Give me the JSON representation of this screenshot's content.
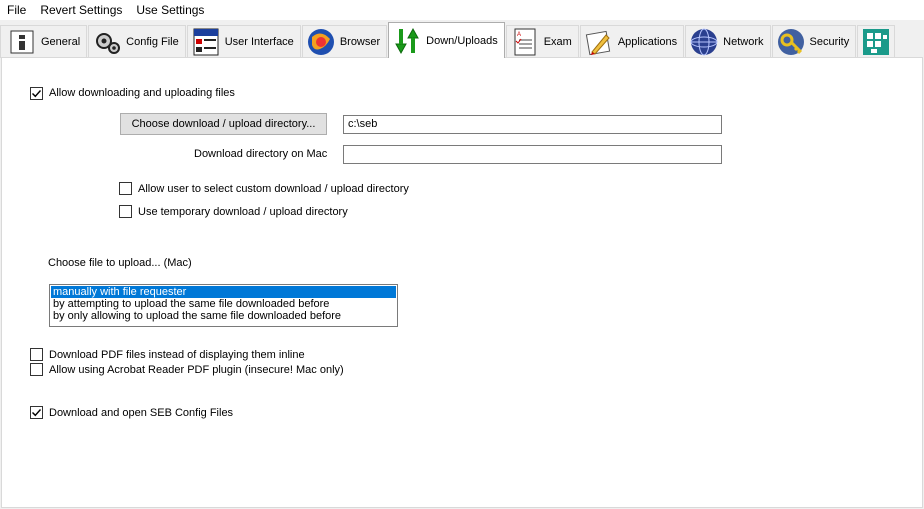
{
  "menu": {
    "file": "File",
    "revert": "Revert Settings",
    "use": "Use Settings"
  },
  "tabs": [
    {
      "label": "General",
      "icon": "general-icon"
    },
    {
      "label": "Config File",
      "icon": "config-file-icon"
    },
    {
      "label": "User Interface",
      "icon": "user-interface-icon"
    },
    {
      "label": "Browser",
      "icon": "browser-icon"
    },
    {
      "label": "Down/Uploads",
      "icon": "down-uploads-icon",
      "active": true
    },
    {
      "label": "Exam",
      "icon": "exam-icon"
    },
    {
      "label": "Applications",
      "icon": "applications-icon"
    },
    {
      "label": "Network",
      "icon": "network-icon"
    },
    {
      "label": "Security",
      "icon": "security-icon"
    },
    {
      "label": "",
      "icon": "registry-icon"
    }
  ],
  "downloads": {
    "allow_label": "Allow downloading and uploading files",
    "allow_checked": true,
    "choose_dir_button": "Choose download / upload directory...",
    "dir_value": "c:\\seb",
    "mac_dir_label": "Download directory on Mac",
    "mac_dir_value": "",
    "custom_dir_label": "Allow user to select custom download / upload directory",
    "custom_dir_checked": false,
    "temp_dir_label": "Use temporary download / upload directory",
    "temp_dir_checked": false,
    "upload_mode_label": "Choose file to upload... (Mac)",
    "upload_options": [
      "manually with file requester",
      "by attempting to upload the same file downloaded before",
      "by only allowing to upload the same file downloaded before"
    ],
    "upload_selected_index": 0,
    "pdf_label": "Download PDF files instead of displaying them inline",
    "pdf_checked": false,
    "acrobat_label": "Allow using Acrobat Reader PDF plugin (insecure! Mac only)",
    "acrobat_checked": false,
    "seb_config_label": "Download and open SEB Config Files",
    "seb_config_checked": true
  },
  "colors": {
    "selection": "#0078d7",
    "arrow_green": "#1a9a1a"
  }
}
